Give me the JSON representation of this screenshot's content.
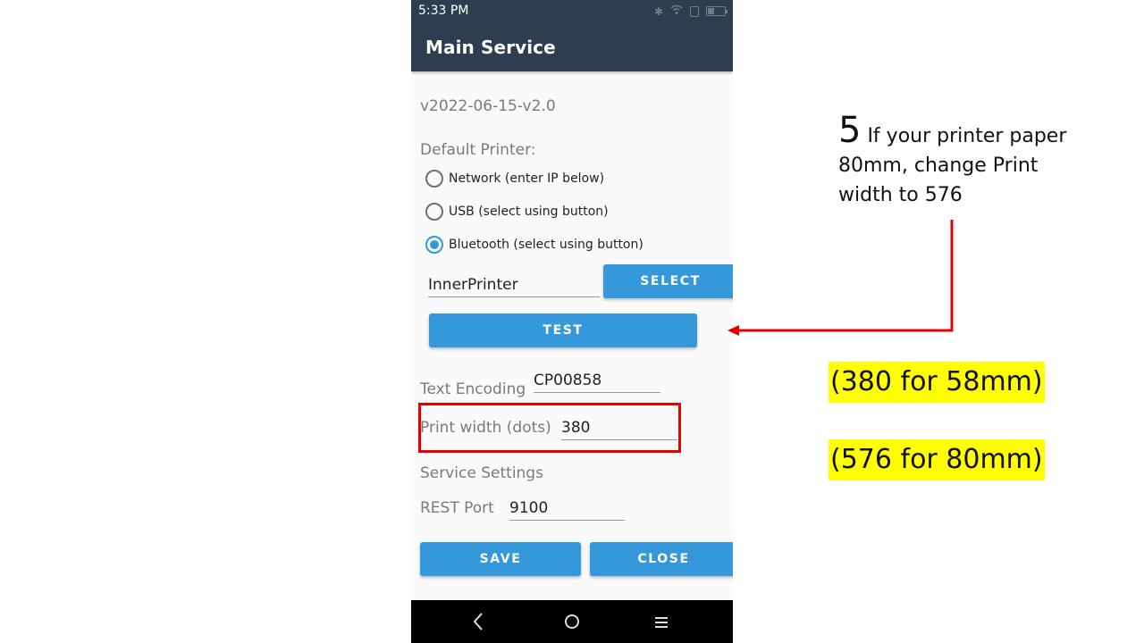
{
  "statusbar": {
    "time": "5:33 PM",
    "icons": [
      "bluetooth-icon",
      "wifi-icon",
      "sim-icon",
      "battery-icon"
    ]
  },
  "appbar": {
    "title": "Main Service"
  },
  "version": "v2022-06-15-v2.0",
  "printer": {
    "label": "Default Printer:",
    "options": [
      {
        "label": "Network (enter IP below)",
        "selected": false
      },
      {
        "label": "USB (select using button)",
        "selected": false
      },
      {
        "label": "Bluetooth (select using button)",
        "selected": true
      }
    ],
    "name_value": "InnerPrinter",
    "select_label": "SELECT",
    "test_label": "TEST"
  },
  "encoding": {
    "label": "Text Encoding",
    "value": "CP00858"
  },
  "print_width": {
    "label": "Print width (dots)",
    "value": "380"
  },
  "service": {
    "label": "Service Settings",
    "rest_label": "REST Port",
    "rest_value": "9100"
  },
  "actions": {
    "save_label": "SAVE",
    "close_label": "CLOSE"
  },
  "navbar": {
    "icons": [
      "back-icon",
      "home-icon",
      "menu-icon"
    ]
  },
  "annotation": {
    "step_number": "5",
    "step_text_1": " If your printer paper",
    "step_text_2": "80mm, change Print",
    "step_text_3": "width to 576",
    "note_58": "(380 for 58mm)",
    "note_80": "(576 for 80mm)",
    "highlight_color": "#ffff00",
    "arrow_color": "#e60000"
  },
  "colors": {
    "appbar": "#2e3d4f",
    "accent": "#3498db"
  }
}
